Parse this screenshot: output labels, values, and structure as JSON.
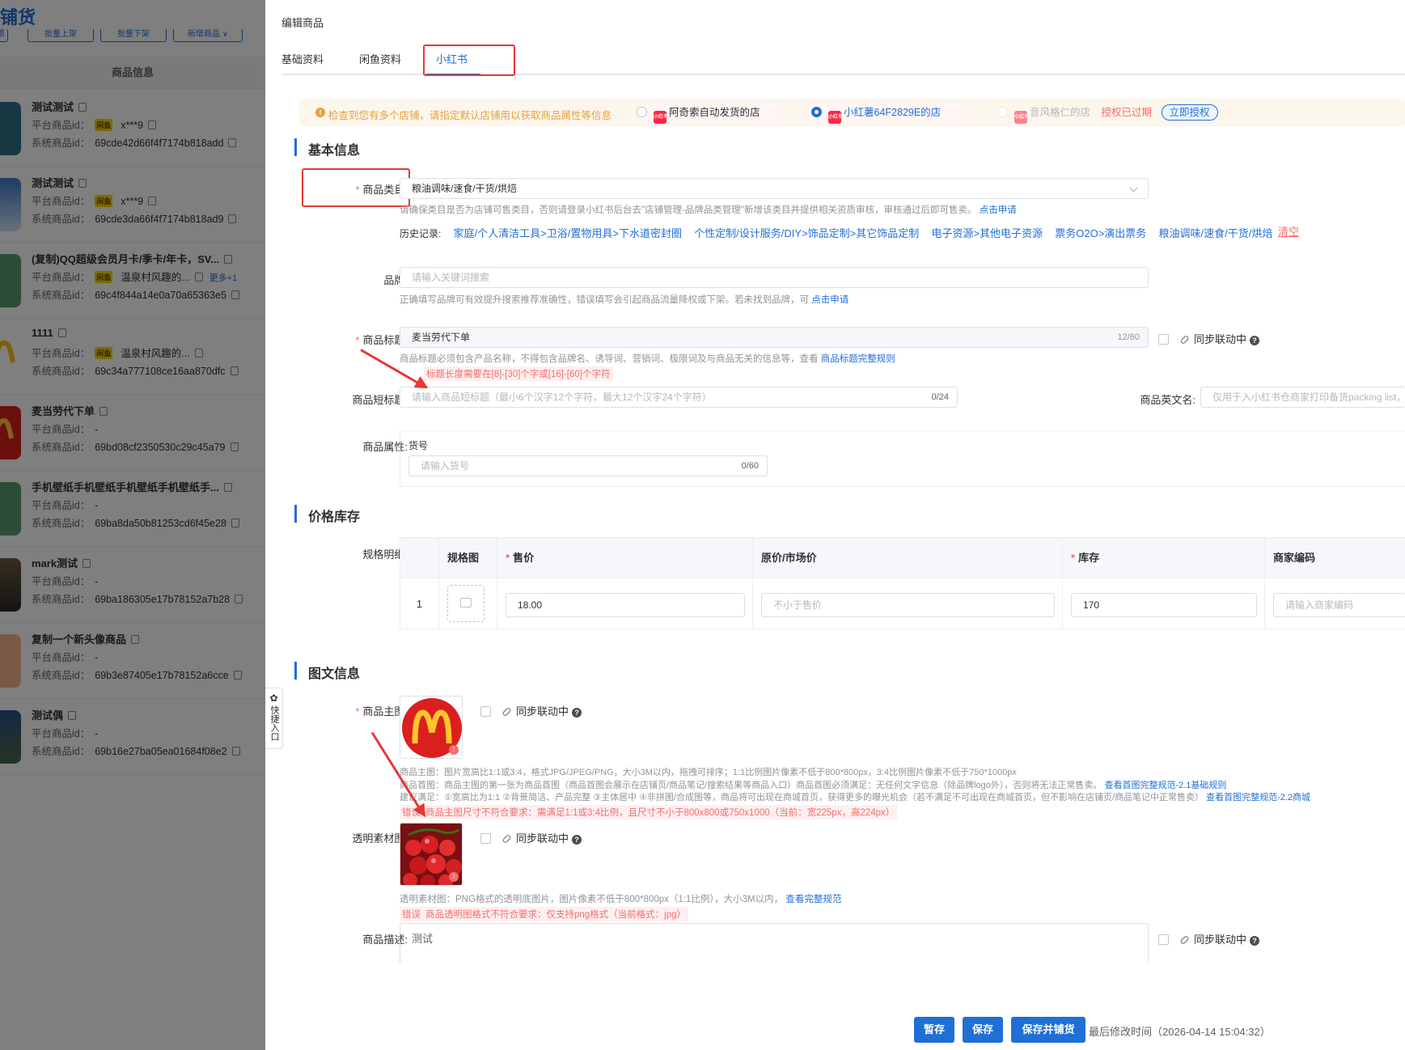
{
  "bg": {
    "title": "铺货",
    "buttons": [
      "项",
      "批量上架",
      "批量下架",
      "新增商品 ∨"
    ],
    "column_header": "商品信息",
    "rows": [
      {
        "name": "测试测试",
        "platform_label": "平台商品id：",
        "platform_val": "x***9",
        "system_label": "系统商品id：",
        "system_val": "69cde42d66f4f7174b818add",
        "shop": "x***9",
        "thumb": "laptop"
      },
      {
        "name": "测试测试",
        "platform_label": "平台商品id：",
        "platform_val": "x***9",
        "system_label": "系统商品id：",
        "system_val": "69cde3da66f4f7174b818ad9",
        "shop": "x***9",
        "thumb": "sky"
      },
      {
        "name": "(复制)QQ超级会员月卡/季卡/年卡，SV...",
        "platform_label": "平台商品id：",
        "platform_val": "温泉村风趣的...",
        "more": "更多+1",
        "system_label": "系统商品id：",
        "system_val": "69c4f844a14e0a70a65363e5",
        "thumb": "green"
      },
      {
        "name": "1111",
        "platform_label": "平台商品id：",
        "platform_val": "温泉村风趣的...",
        "system_label": "系统商品id：",
        "system_val": "69c34a777108ce16aa870dfc",
        "thumb": "m"
      },
      {
        "name": "麦当劳代下单",
        "platform_label": "平台商品id：",
        "platform_val": "-",
        "system_label": "系统商品id：",
        "system_val": "69bd08cf2350530c29c45a79",
        "thumb": "mred"
      },
      {
        "name": "手机壁纸手机壁纸手机壁纸手机壁纸手...",
        "platform_label": "平台商品id：",
        "platform_val": "-",
        "system_label": "系统商品id：",
        "system_val": "69ba8da50b81253cd6f45e28",
        "thumb": "green"
      },
      {
        "name": "mark测试",
        "platform_label": "平台商品id：",
        "platform_val": "-",
        "system_label": "系统商品id：",
        "system_val": "69ba186305e17b78152a7b28",
        "thumb": "photo"
      },
      {
        "name": "复制一个新头像商品",
        "platform_label": "平台商品id：",
        "platform_val": "-",
        "system_label": "系统商品id：",
        "system_val": "69b3e87405e17b78152a6cce",
        "thumb": "avatar"
      },
      {
        "name": "测试偶",
        "platform_label": "平台商品id：",
        "platform_val": "-",
        "system_label": "系统商品id：",
        "system_val": "69b16e27ba05ea01684f08e2",
        "thumb": "city"
      }
    ]
  },
  "drawer": {
    "title": "编辑商品",
    "tabs": [
      "基础资料",
      "闲鱼资料",
      "小红书"
    ],
    "notice": "检查到您有多个店铺，请指定默认店铺用以获取商品属性等信息",
    "shops": [
      "阿奇索自动发货的店",
      "小红薯64F2829E的店",
      "音风格仁的店"
    ],
    "expired": "授权已过期",
    "authorize": "立即授权",
    "xhs_icon": "小红书",
    "sections": {
      "basic": "基本信息",
      "price": "价格库存",
      "media": "图文信息"
    },
    "category": {
      "label": "商品类目:",
      "value": "粮油调味/速食/干货/烘焙",
      "hint": "请确保类目是否为店铺可售类目，否则请登录小红书后台去\"店铺管理-品牌品类管理\"新增该类目并提供相关资质审核，审核通过后即可售卖。",
      "hint_link": "点击申请",
      "history_label": "历史记录:",
      "history": [
        "家庭/个人清洁工具>卫浴/置物用具>下水道密封圈",
        "个性定制/设计服务/DIY>饰品定制>其它饰品定制",
        "电子资源>其他电子资源",
        "票务O2O>演出票务",
        "粮油调味/速食/干货/烘焙"
      ],
      "clear": "清空"
    },
    "brand": {
      "label": "品牌:",
      "placeholder": "请输入关键词搜索",
      "hint": "正确填写品牌可有效提升搜索推荐准确性，错误填写会引起商品流量降权或下架。若未找到品牌，可",
      "hint_link": "点击申请"
    },
    "title_field": {
      "label": "商品标题:",
      "value": "麦当劳代下单",
      "count": "12/60",
      "sync": "同步联动中",
      "hint": "商品标题必须包含产品名称，不得包含品牌名、诱导词、营销词、极限词及与商品无关的信息等，查看",
      "hint_link": "商品标题完整规则",
      "error": "标题长度需要在[8]-[30]个字或[16]-[60]个字符"
    },
    "short_title": {
      "label": "商品短标题:",
      "placeholder": "请输入商品短标题（最小6个汉字12个字符，最大12个汉字24个字符）",
      "count": "0/24"
    },
    "english_name": {
      "label": "商品英文名:",
      "placeholder": "仅用于入小红书仓商家打印备货packing list，"
    },
    "attributes": {
      "label": "商品属性:",
      "sku_label": "货号",
      "sku_placeholder": "请输入货号",
      "sku_count": "0/60"
    },
    "spec": {
      "label": "规格明细:",
      "headers": [
        "规格图",
        "售价",
        "原价/市场价",
        "库存",
        "商家编码"
      ],
      "row_index": "1",
      "price": "18.00",
      "orig_placeholder": "不小于售价",
      "stock": "170",
      "code_placeholder": "请输入商家编码"
    },
    "main_image": {
      "label": "商品主图:",
      "sync": "同步联动中",
      "hint1": "商品主图：图片宽高比1:1或3:4，格式JPG/JPEG/PNG，大小3M以内，拖拽可排序；1:1比例图片像素不低于800*800px，3:4比例图片像素不低于750*1000px",
      "hint2": "商品首图：商品主图的第一张为商品首图（商品首图会展示在店铺页/商品笔记/搜索结果等商品入口）商品首图必须满足：无任何文字信息（除品牌logo外），否则将无法正常售卖。",
      "hint2_link": "查看首图完整规范-2.1基础规则",
      "hint3": "建议满足：①宽高比为1:1 ②背景简洁、产品完整 ③主体居中 ④非拼图/合成图等，商品将可出现在商城首页，获得更多的曝光机会（若不满足不可出现在商城首页，但不影响在店铺页/商品笔记中正常售卖）",
      "hint3_link": "查看首图完整规范-2.2商城",
      "error_tag": "错误",
      "error": "商品主图尺寸不符合要求：需满足1:1或3:4比例，且尺寸不小于800x800或750x1000（当前：宽225px，高224px）"
    },
    "transparent_image": {
      "label": "透明素材图:",
      "sync": "同步联动中",
      "hint": "透明素材图：PNG格式的透明底图片，图片像素不低于800*800px（1:1比例），大小3M以内，",
      "hint_link": "查看完整规范",
      "error_tag": "错误",
      "error": "商品透明图格式不符合要求：仅支持png格式（当前格式：jpg）"
    },
    "description": {
      "label": "商品描述:",
      "value": "测试",
      "sync": "同步联动中"
    },
    "quick_entry": "快捷入口",
    "buttons": {
      "draft": "暂存",
      "save": "保存",
      "save_publish": "保存并铺货"
    },
    "last_modified": "最后修改时间（2026-04-14 15:04:32）"
  },
  "colors": {
    "accent": "#1f6fd6",
    "danger": "#f56c6c",
    "warning": "#e6a23c",
    "annotation": "#e53935"
  }
}
